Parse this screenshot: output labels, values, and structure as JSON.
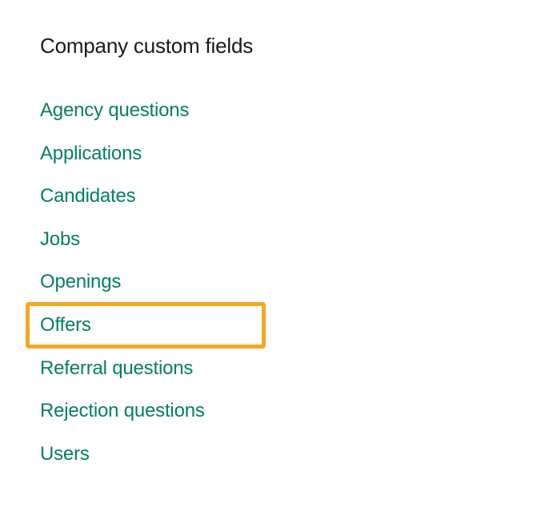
{
  "section": {
    "title": "Company custom fields"
  },
  "nav": {
    "items": [
      {
        "label": "Agency questions",
        "highlighted": false
      },
      {
        "label": "Applications",
        "highlighted": false
      },
      {
        "label": "Candidates",
        "highlighted": false
      },
      {
        "label": "Jobs",
        "highlighted": false
      },
      {
        "label": "Openings",
        "highlighted": false
      },
      {
        "label": "Offers",
        "highlighted": true
      },
      {
        "label": "Referral questions",
        "highlighted": false
      },
      {
        "label": "Rejection questions",
        "highlighted": false
      },
      {
        "label": "Users",
        "highlighted": false
      }
    ]
  }
}
